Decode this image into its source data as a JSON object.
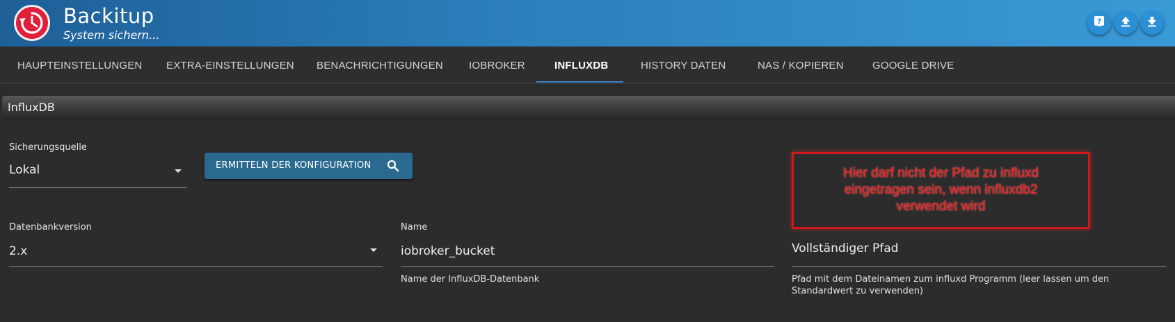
{
  "app": {
    "title": "Backitup",
    "subtitle": "System sichern..."
  },
  "header_buttons": [
    {
      "icon": "help-icon"
    },
    {
      "icon": "upload-icon"
    },
    {
      "icon": "download-icon"
    }
  ],
  "tabs": [
    {
      "label": "HAUPTEINSTELLUNGEN",
      "active": false
    },
    {
      "label": "EXTRA-EINSTELLUNGEN",
      "active": false
    },
    {
      "label": "BENACHRICHTIGUNGEN",
      "active": false
    },
    {
      "label": "IOBROKER",
      "active": false
    },
    {
      "label": "INFLUXDB",
      "active": true
    },
    {
      "label": "HISTORY DATEN",
      "active": false
    },
    {
      "label": "NAS / KOPIEREN",
      "active": false
    },
    {
      "label": "GOOGLE DRIVE",
      "active": false
    }
  ],
  "section": {
    "title": "InfluxDB"
  },
  "form": {
    "source": {
      "label": "Sicherungsquelle",
      "value": "Lokal"
    },
    "detect_button": {
      "label": "ERMITTELN DER KONFIGURATION"
    },
    "db_version": {
      "label": "Datenbankversion",
      "value": "2.x"
    },
    "name": {
      "label": "Name",
      "value": "iobroker_bucket",
      "helper": "Name der InfluxDB-Datenbank"
    },
    "full_path": {
      "label": "Vollständiger Pfad",
      "value": "",
      "helper_line1": "Pfad mit dem Dateinamen zum influxd Programm (leer lassen um den",
      "helper_line2": "Standardwert zu verwenden)"
    }
  },
  "annotation": {
    "line1": "Hier darf nicht der Pfad zu influxd",
    "line2": "eingetragen sein, wenn influxdb2",
    "line3": "verwendet wird"
  },
  "colors": {
    "header_accent": "#2a7db8",
    "logo_red": "#e0203a",
    "tab_indicator": "#3c82c6",
    "button_bg": "#2a6a90",
    "annotation_red": "#d01818",
    "background": "#2c2c2c"
  }
}
